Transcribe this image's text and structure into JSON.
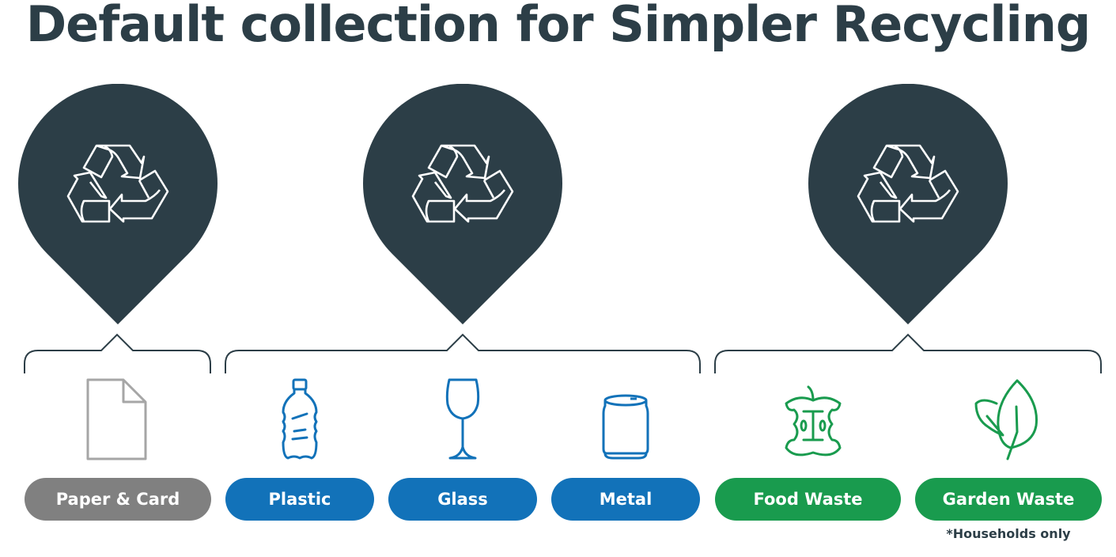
{
  "title": "Default collection for Simpler Recycling",
  "colors": {
    "dark": "#2c3e47",
    "paper": "#808080",
    "dry": "#1272b9",
    "organic": "#199b4e"
  },
  "groups": [
    {
      "name": "paper-card-group",
      "pin_icon": "recycle-icon",
      "items": [
        {
          "label": "Paper & Card",
          "icon": "paper-sheet-icon",
          "color": "grey"
        }
      ]
    },
    {
      "name": "plastic-glass-metal-group",
      "pin_icon": "recycle-icon",
      "items": [
        {
          "label": "Plastic",
          "icon": "plastic-bottle-icon",
          "color": "blue"
        },
        {
          "label": "Glass",
          "icon": "wine-glass-icon",
          "color": "blue"
        },
        {
          "label": "Metal",
          "icon": "can-icon",
          "color": "blue"
        }
      ]
    },
    {
      "name": "food-garden-group",
      "pin_icon": "recycle-icon",
      "items": [
        {
          "label": "Food Waste",
          "icon": "apple-core-icon",
          "color": "green"
        },
        {
          "label": "Garden Waste",
          "icon": "leaves-icon",
          "color": "green"
        }
      ]
    }
  ],
  "footnote": "*Households only"
}
